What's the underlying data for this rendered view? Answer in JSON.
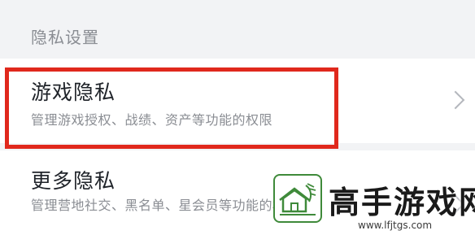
{
  "section": {
    "title": "隐私设置"
  },
  "items": [
    {
      "title": "游戏隐私",
      "description": "管理游戏授权、战绩、资产等功能的权限"
    },
    {
      "title": "更多隐私",
      "description": "管理营地社交、黑名单、星会员等功能的权限"
    }
  ],
  "highlight": {
    "color": "#e0281c"
  },
  "watermark": {
    "title": "高手游戏网",
    "url": "www.lfjtgs.com"
  }
}
